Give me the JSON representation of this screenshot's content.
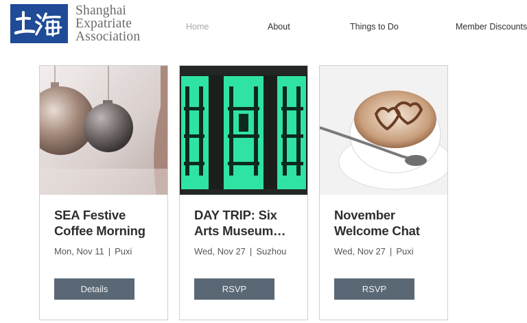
{
  "header": {
    "logo_line1": "Shanghai",
    "logo_line2": "Expatriate",
    "logo_line3": "Association",
    "logo_mark_text": "上海"
  },
  "nav": [
    {
      "label": "Home",
      "active": true
    },
    {
      "label": "About"
    },
    {
      "label": "Things to Do"
    },
    {
      "label": "Member Discounts"
    }
  ],
  "events": [
    {
      "title_line1": "SEA Festive",
      "title_line2": "Coffee Morning",
      "date": "Mon, Nov 11",
      "location": "Puxi",
      "button": "Details"
    },
    {
      "title_line1": "DAY TRIP: Six",
      "title_line2": "Arts Museum…",
      "date": "Wed, Nov 27",
      "location": "Suzhou",
      "button": "RSVP"
    },
    {
      "title_line1": "November",
      "title_line2": "Welcome Chat",
      "date": "Wed, Nov 27",
      "location": "Puxi",
      "button": "RSVP"
    }
  ],
  "meta_separator": "|",
  "colors": {
    "brand_blue": "#1f4b97",
    "button_bg": "#5a6875",
    "active_nav": "#a9a9a9"
  }
}
